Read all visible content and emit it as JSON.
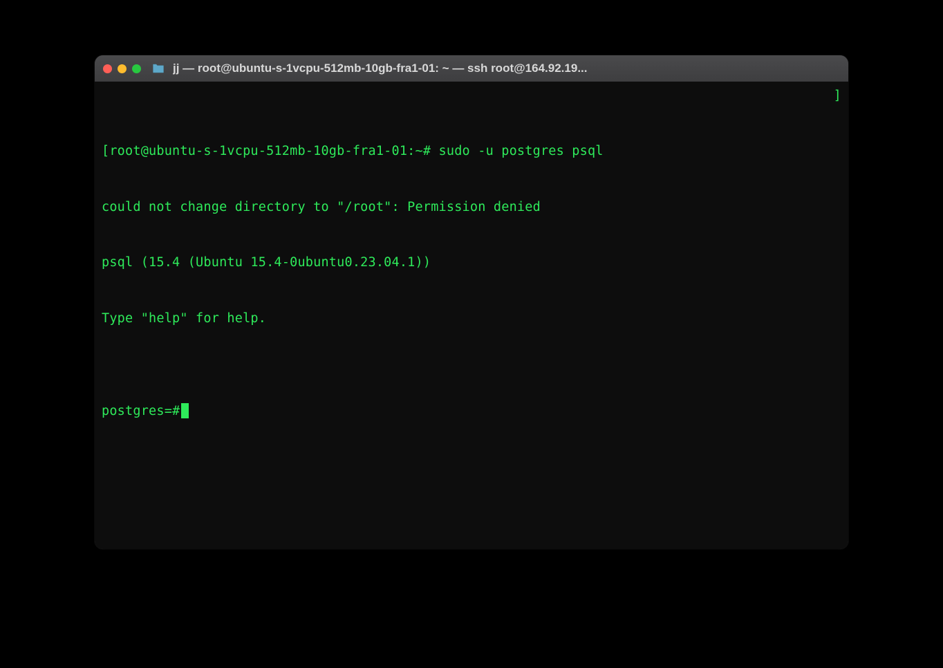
{
  "window": {
    "title": "jj — root@ubuntu-s-1vcpu-512mb-10gb-fra1-01: ~ — ssh root@164.92.19..."
  },
  "terminal": {
    "left_bracket": "[",
    "prompt": "root@ubuntu-s-1vcpu-512mb-10gb-fra1-01:~#",
    "command": "sudo -u postgres psql",
    "right_bracket": "]",
    "lines": [
      "could not change directory to \"/root\": Permission denied",
      "psql (15.4 (Ubuntu 15.4-0ubuntu0.23.04.1))",
      "Type \"help\" for help.",
      ""
    ],
    "current_prompt": "postgres=#"
  }
}
